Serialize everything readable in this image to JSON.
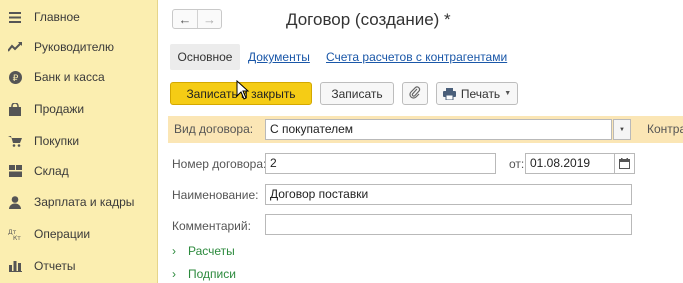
{
  "sidebar": {
    "items": [
      {
        "label": "Главное",
        "icon": "hamburger-icon"
      },
      {
        "label": "Руководителю",
        "icon": "trend-icon"
      },
      {
        "label": "Банк и касса",
        "icon": "ruble-icon"
      },
      {
        "label": "Продажи",
        "icon": "bag-icon"
      },
      {
        "label": "Покупки",
        "icon": "cart-icon"
      },
      {
        "label": "Склад",
        "icon": "warehouse-icon"
      },
      {
        "label": "Зарплата и кадры",
        "icon": "person-icon"
      },
      {
        "label": "Операции",
        "icon": "operations-icon"
      },
      {
        "label": "Отчеты",
        "icon": "bar-chart-icon"
      }
    ]
  },
  "header": {
    "back": "←",
    "forward": "→",
    "title": "Договор (создание) *"
  },
  "tabs": {
    "main": "Основное",
    "documents": "Документы",
    "accounts": "Счета расчетов с контрагентами"
  },
  "toolbar": {
    "save_close": "Записать и закрыть",
    "save": "Записать",
    "print": "Печать"
  },
  "form": {
    "contract_type_label": "Вид договора:",
    "contract_type_value": "С покупателем",
    "counterparty_label": "Контрагент",
    "number_label": "Номер договора:",
    "number_value": "2",
    "from_label": "от:",
    "date_value": "01.08.2019",
    "name_label": "Наименование:",
    "name_value": "Договор поставки",
    "comment_label": "Комментарий:",
    "comment_value": ""
  },
  "sections": {
    "payments": "Расчеты",
    "signatures": "Подписи"
  },
  "colors": {
    "sidebar_bg": "#fbeeb0",
    "primary_button": "#f5cc15",
    "highlight_row": "#fbe6b5",
    "link": "#1a57a8",
    "section_green": "#2c8a3d"
  }
}
